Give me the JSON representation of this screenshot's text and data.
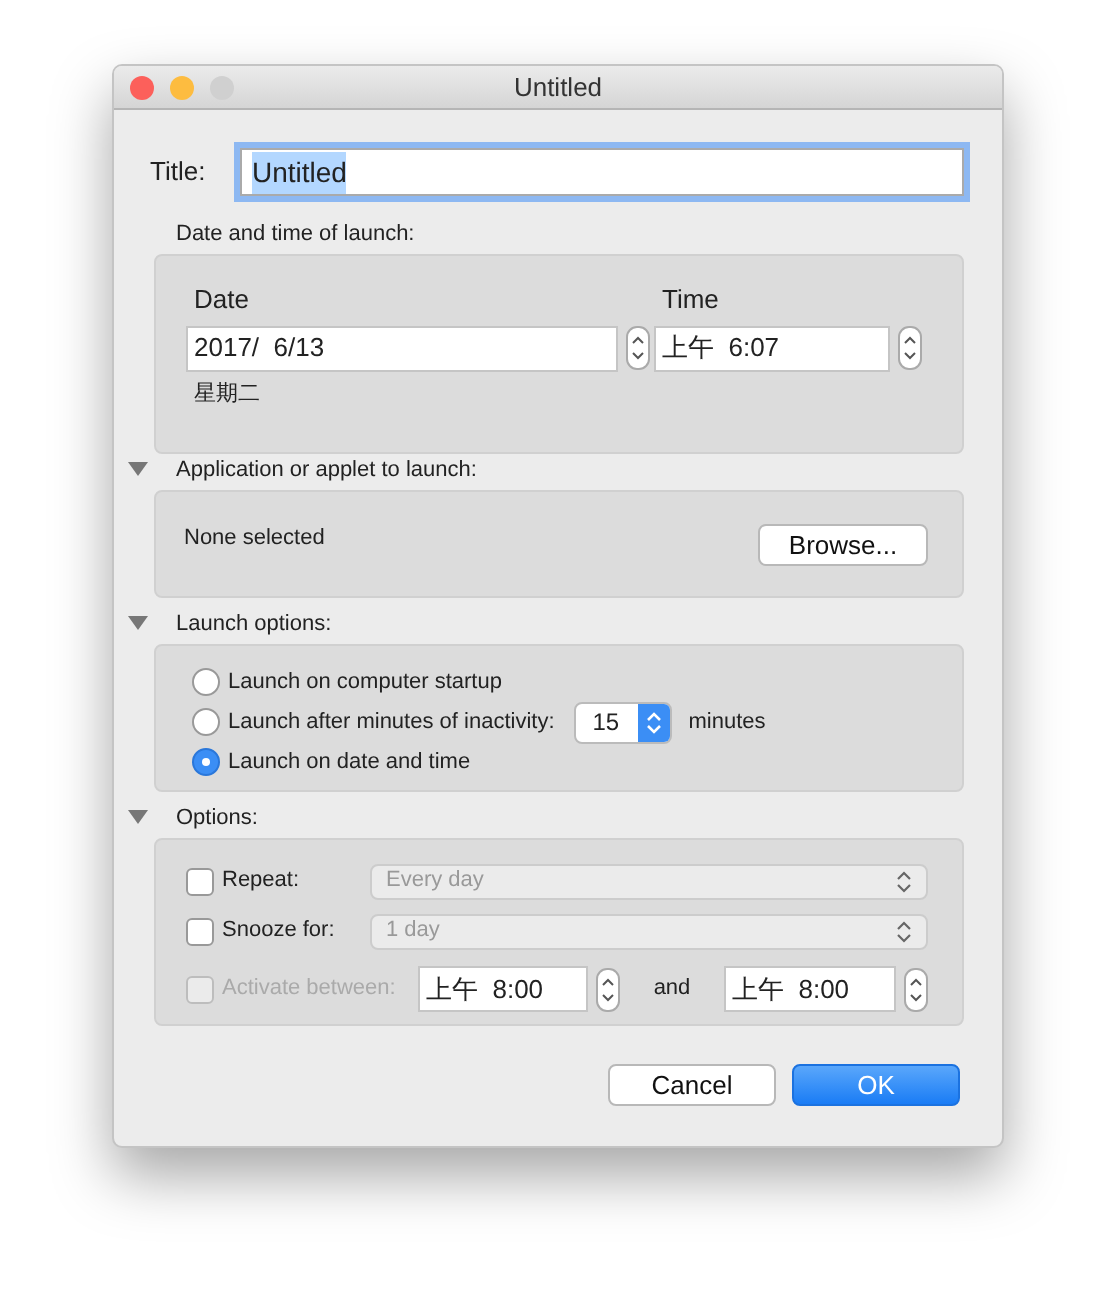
{
  "window": {
    "title": "Untitled",
    "traffic_lights": [
      {
        "color": "#fc605b"
      },
      {
        "color": "#fdbc40"
      },
      {
        "color": "#d0d0d0"
      }
    ]
  },
  "title_field": {
    "label": "Title:",
    "value": "Untitled",
    "focused": true,
    "value_selected": true
  },
  "date_time": {
    "label": "Date and time of launch:",
    "date_label": "Date",
    "date_value": "2017/  6/13",
    "weekday": "星期二",
    "time_label": "Time",
    "time_value": "上午  6:07"
  },
  "application": {
    "expanded": true,
    "label": "Application or applet to launch:",
    "selection": "None selected",
    "browse_button": "Browse..."
  },
  "launch_options": {
    "expanded": true,
    "label": "Launch options:",
    "choices": [
      {
        "label": "Launch on computer startup",
        "selected": false
      },
      {
        "label": "Launch after minutes of inactivity:",
        "selected": false,
        "minutes": "15",
        "unit": "minutes"
      },
      {
        "label": "Launch on date and time",
        "selected": true
      }
    ]
  },
  "options": {
    "expanded": true,
    "label": "Options:",
    "rows": [
      {
        "kind": "popup",
        "label": "Repeat:",
        "checked": false,
        "disabled": false,
        "value": "Every day",
        "popup_disabled": true
      },
      {
        "kind": "popup",
        "label": "Snooze for:",
        "checked": false,
        "disabled": false,
        "value": "1 day",
        "popup_disabled": true
      },
      {
        "kind": "range",
        "label": "Activate between:",
        "checked": false,
        "disabled": true,
        "from": "上午  8:00",
        "joiner": "and",
        "to": "上午  8:00"
      }
    ]
  },
  "buttons": [
    {
      "label": "Cancel",
      "default": false
    },
    {
      "label": "OK",
      "default": true
    }
  ]
}
